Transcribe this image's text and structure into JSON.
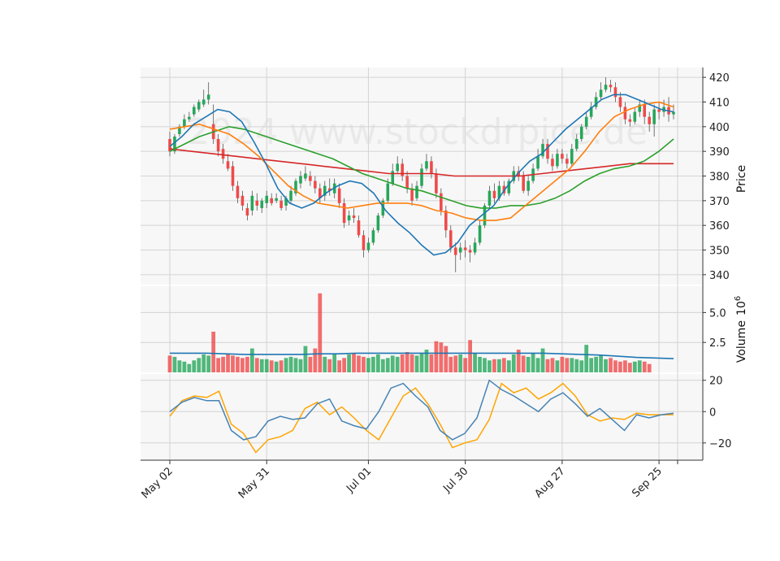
{
  "chart_data": {
    "type": "candlestick",
    "watermark": "2024 www.stockdrpice.de",
    "x_tick_labels": [
      "May 02",
      "May 31",
      "Jul 01",
      "Jul 30",
      "Aug 27",
      "Sep 25"
    ],
    "x_tick_index": [
      0,
      20,
      41,
      61,
      81,
      101
    ],
    "price_axis": {
      "label": "Price",
      "ylim": [
        336,
        424
      ],
      "ticks": [
        340,
        350,
        360,
        370,
        380,
        390,
        400,
        410,
        420
      ]
    },
    "volume_axis": {
      "label": "Volume",
      "exponent_label": "10",
      "exponent": "6",
      "ylim": [
        0,
        7.2
      ],
      "ticks": [
        2.5,
        5.0
      ],
      "tick_labels": [
        "2.5",
        "5.0"
      ]
    },
    "oscillator_axis": {
      "ylim": [
        -31,
        24
      ],
      "ticks": [
        20,
        0,
        -20
      ],
      "tick_labels": [
        "20",
        "0",
        "−20"
      ]
    },
    "colors": {
      "up": "#26a65b",
      "down": "#ef4a4a",
      "ma_fast": "#1f77b4",
      "ma_mid": "#ff7f0e",
      "ma_slow": "#2ca02c",
      "ma_long": "#d62728",
      "vol_ma": "#1f77b4",
      "osc_1": "#4682b4",
      "osc_2": "#ffa500",
      "panel_bg": "#f7f7f7",
      "grid": "#d3d3d3"
    },
    "candles": [
      [
        395,
        390,
        398,
        388
      ],
      [
        390,
        396,
        397,
        389
      ],
      [
        397,
        400,
        401,
        396
      ],
      [
        400,
        403,
        405,
        399
      ],
      [
        403,
        404,
        406,
        402
      ],
      [
        405,
        408,
        409,
        404
      ],
      [
        407,
        410,
        411,
        406
      ],
      [
        409,
        411,
        415,
        408
      ],
      [
        411,
        413,
        418,
        409
      ],
      [
        401,
        395,
        409,
        393
      ],
      [
        395,
        390,
        397,
        388
      ],
      [
        391,
        387,
        393,
        385
      ],
      [
        386,
        383,
        389,
        382
      ],
      [
        384,
        376,
        386,
        374
      ],
      [
        376,
        371,
        378,
        369
      ],
      [
        372,
        368,
        374,
        366
      ],
      [
        367,
        364,
        369,
        362
      ],
      [
        366,
        372,
        374,
        364
      ],
      [
        370,
        368,
        373,
        366
      ],
      [
        367,
        370,
        371,
        365
      ],
      [
        369,
        372,
        374,
        367
      ],
      [
        371,
        369,
        373,
        368
      ],
      [
        370,
        371,
        373,
        369
      ],
      [
        370,
        367,
        372,
        366
      ],
      [
        368,
        371,
        372,
        366
      ],
      [
        370,
        374,
        376,
        369
      ],
      [
        373,
        378,
        379,
        372
      ],
      [
        377,
        380,
        382,
        375
      ],
      [
        379,
        381,
        384,
        378
      ],
      [
        380,
        378,
        382,
        376
      ],
      [
        378,
        375,
        380,
        373
      ],
      [
        375,
        371,
        377,
        369
      ],
      [
        372,
        376,
        378,
        370
      ],
      [
        375,
        374,
        379,
        372
      ],
      [
        373,
        377,
        379,
        371
      ],
      [
        375,
        369,
        377,
        367
      ],
      [
        369,
        361,
        371,
        359
      ],
      [
        362,
        364,
        366,
        360
      ],
      [
        364,
        363,
        367,
        361
      ],
      [
        362,
        356,
        364,
        355
      ],
      [
        356,
        350,
        358,
        347
      ],
      [
        350,
        353,
        355,
        349
      ],
      [
        353,
        358,
        359,
        352
      ],
      [
        358,
        364,
        365,
        357
      ],
      [
        364,
        370,
        371,
        363
      ],
      [
        370,
        377,
        379,
        369
      ],
      [
        377,
        382,
        385,
        376
      ],
      [
        382,
        385,
        388,
        381
      ],
      [
        385,
        380,
        387,
        378
      ],
      [
        380,
        375,
        382,
        373
      ],
      [
        375,
        370,
        377,
        368
      ],
      [
        371,
        376,
        378,
        370
      ],
      [
        376,
        383,
        385,
        375
      ],
      [
        383,
        386,
        389,
        382
      ],
      [
        386,
        381,
        388,
        379
      ],
      [
        381,
        373,
        383,
        371
      ],
      [
        373,
        366,
        375,
        364
      ],
      [
        366,
        358,
        368,
        355
      ],
      [
        358,
        351,
        360,
        349
      ],
      [
        351,
        348,
        353,
        341
      ],
      [
        349,
        351,
        353,
        346
      ],
      [
        351,
        350,
        354,
        347
      ],
      [
        350,
        349,
        352,
        345
      ],
      [
        349,
        353,
        355,
        348
      ],
      [
        353,
        360,
        362,
        352
      ],
      [
        360,
        368,
        369,
        359
      ],
      [
        368,
        374,
        376,
        367
      ],
      [
        374,
        371,
        377,
        369
      ],
      [
        371,
        376,
        378,
        370
      ],
      [
        376,
        373,
        378,
        372
      ],
      [
        373,
        378,
        379,
        372
      ],
      [
        378,
        382,
        384,
        377
      ],
      [
        382,
        380,
        384,
        378
      ],
      [
        380,
        374,
        382,
        373
      ],
      [
        374,
        378,
        380,
        372
      ],
      [
        378,
        383,
        385,
        377
      ],
      [
        383,
        388,
        391,
        382
      ],
      [
        388,
        393,
        395,
        387
      ],
      [
        393,
        387,
        395,
        385
      ],
      [
        387,
        384,
        389,
        382
      ],
      [
        384,
        389,
        391,
        383
      ],
      [
        389,
        387,
        391,
        385
      ],
      [
        387,
        385,
        389,
        383
      ],
      [
        385,
        391,
        393,
        384
      ],
      [
        391,
        395,
        397,
        390
      ],
      [
        395,
        400,
        401,
        394
      ],
      [
        400,
        404,
        406,
        399
      ],
      [
        404,
        408,
        410,
        403
      ],
      [
        408,
        412,
        414,
        407
      ],
      [
        412,
        415,
        418,
        411
      ],
      [
        415,
        417,
        420,
        414
      ],
      [
        417,
        416,
        419,
        414
      ],
      [
        416,
        412,
        418,
        410
      ],
      [
        412,
        408,
        414,
        406
      ],
      [
        408,
        403,
        410,
        401
      ],
      [
        403,
        402,
        405,
        400
      ],
      [
        402,
        406,
        408,
        401
      ],
      [
        406,
        409,
        411,
        404
      ],
      [
        409,
        404,
        411,
        401
      ],
      [
        404,
        401,
        406,
        398
      ],
      [
        401,
        407,
        409,
        396
      ],
      [
        407,
        406,
        410,
        403
      ],
      [
        406,
        408,
        411,
        404
      ],
      [
        408,
        405,
        412,
        402
      ],
      [
        405,
        406,
        409,
        403
      ]
    ],
    "volume": [
      1.4,
      1.3,
      1.0,
      0.9,
      0.7,
      1.0,
      1.2,
      1.5,
      1.4,
      3.4,
      1.2,
      1.3,
      1.5,
      1.4,
      1.3,
      1.2,
      1.3,
      2.0,
      1.2,
      1.1,
      1.1,
      1.0,
      0.9,
      1.0,
      1.2,
      1.3,
      1.2,
      1.1,
      2.2,
      1.3,
      2.0,
      6.6,
      1.3,
      1.1,
      1.5,
      1.0,
      1.2,
      1.5,
      1.6,
      1.4,
      1.3,
      1.2,
      1.3,
      1.5,
      1.1,
      1.2,
      1.4,
      1.3,
      1.5,
      1.7,
      1.5,
      1.4,
      1.6,
      1.9,
      1.5,
      2.6,
      2.5,
      2.2,
      1.3,
      1.4,
      1.5,
      1.2,
      2.7,
      1.6,
      1.3,
      1.2,
      1.0,
      1.1,
      1.1,
      1.2,
      1.0,
      1.5,
      1.9,
      1.4,
      1.3,
      1.6,
      1.2,
      2.0,
      1.1,
      1.2,
      1.0,
      1.3,
      1.2,
      1.2,
      1.1,
      1.0,
      2.3,
      1.2,
      1.3,
      1.4,
      1.1,
      1.2,
      1.0,
      0.9,
      1.0,
      0.8,
      0.9,
      1.0,
      0.9,
      0.7
    ],
    "volume_ma": [
      1.6,
      1.6,
      1.6,
      1.55,
      1.5,
      1.5,
      1.5,
      1.5,
      1.55,
      1.55,
      1.6,
      1.6,
      1.6,
      1.6,
      1.6,
      1.6,
      1.6,
      1.6,
      1.6,
      1.6,
      1.6,
      1.55,
      1.5,
      1.45,
      1.35,
      1.25,
      1.2,
      1.15
    ],
    "ma_fast": [
      392,
      396,
      401,
      404,
      407,
      406,
      402,
      394,
      385,
      375,
      369,
      367,
      369,
      373,
      376,
      378,
      377,
      373,
      366,
      361,
      357,
      352,
      348,
      349,
      353,
      360,
      364,
      368,
      375,
      381,
      386,
      389,
      394,
      399,
      403,
      407,
      411,
      413,
      413,
      411,
      409,
      407,
      406
    ],
    "ma_mid": [
      399,
      400,
      401,
      399,
      397,
      393,
      388,
      382,
      376,
      372,
      369,
      368,
      367,
      368,
      369,
      369,
      369,
      368,
      366,
      365,
      363,
      362,
      362,
      363,
      368,
      373,
      378,
      383,
      390,
      398,
      404,
      407,
      409,
      410,
      408
    ],
    "ma_slow": [
      390,
      393,
      396,
      398,
      400,
      399,
      397,
      395,
      393,
      391,
      389,
      387,
      384,
      381,
      379,
      377,
      375,
      374,
      372,
      370,
      368,
      367,
      367,
      368,
      368,
      369,
      371,
      374,
      378,
      381,
      383,
      384,
      386,
      390,
      395
    ],
    "ma_long": [
      391,
      390,
      389,
      388,
      387,
      386,
      385,
      384,
      383,
      382,
      381,
      381,
      381,
      380,
      380,
      380,
      380,
      381,
      382,
      383,
      384,
      385,
      385,
      385
    ],
    "osc_1": [
      0,
      6,
      9,
      7,
      7,
      -12,
      -18,
      -16,
      -6,
      -3,
      -5,
      -4,
      5,
      8,
      -6,
      -9,
      -11,
      0,
      15,
      18,
      10,
      3,
      -12,
      -18,
      -14,
      -4,
      20,
      14,
      10,
      5,
      0,
      8,
      12,
      5,
      -3,
      2,
      -5,
      -12,
      -2,
      -4,
      -2,
      -1
    ],
    "osc_2": [
      -3,
      7,
      10,
      9,
      13,
      -8,
      -14,
      -26,
      -18,
      -16,
      -12,
      2,
      6,
      -2,
      3,
      -4,
      -12,
      -18,
      -4,
      10,
      15,
      5,
      -8,
      -23,
      -20,
      -18,
      -5,
      18,
      12,
      15,
      8,
      12,
      18,
      10,
      -2,
      -6,
      -4,
      -5,
      -1,
      -2,
      -2,
      -2
    ]
  }
}
